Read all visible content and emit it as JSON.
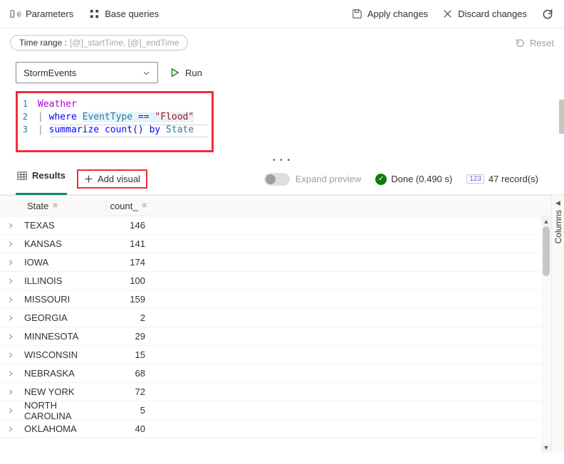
{
  "toolbar": {
    "parameters": "Parameters",
    "base_queries": "Base queries",
    "apply": "Apply changes",
    "discard": "Discard changes"
  },
  "timerange": {
    "label": "Time range :",
    "params": "[@]_startTime, [@]_endTime",
    "reset": "Reset"
  },
  "query": {
    "dropdown": "StormEvents",
    "run": "Run",
    "lines": {
      "l1": "Weather",
      "l2_kw": "where",
      "l2_id": "EventType",
      "l2_op": "==",
      "l2_str": "\"Flood\"",
      "l3_kw": "summarize",
      "l3_fn": "count()",
      "l3_by": "by",
      "l3_id": "State"
    }
  },
  "tabs": {
    "results": "Results",
    "addvisual": "Add visual"
  },
  "status": {
    "expand": "Expand preview",
    "done": "Done (0.490 s)",
    "records": "47 record(s)",
    "badge": "123"
  },
  "grid": {
    "col1": "State",
    "col2": "count_",
    "sidepanel": "Columns",
    "rows": [
      {
        "state": "TEXAS",
        "count": "146"
      },
      {
        "state": "KANSAS",
        "count": "141"
      },
      {
        "state": "IOWA",
        "count": "174"
      },
      {
        "state": "ILLINOIS",
        "count": "100"
      },
      {
        "state": "MISSOURI",
        "count": "159"
      },
      {
        "state": "GEORGIA",
        "count": "2"
      },
      {
        "state": "MINNESOTA",
        "count": "29"
      },
      {
        "state": "WISCONSIN",
        "count": "15"
      },
      {
        "state": "NEBRASKA",
        "count": "68"
      },
      {
        "state": "NEW YORK",
        "count": "72"
      },
      {
        "state": "NORTH CAROLINA",
        "count": "5"
      },
      {
        "state": "OKLAHOMA",
        "count": "40"
      }
    ]
  }
}
